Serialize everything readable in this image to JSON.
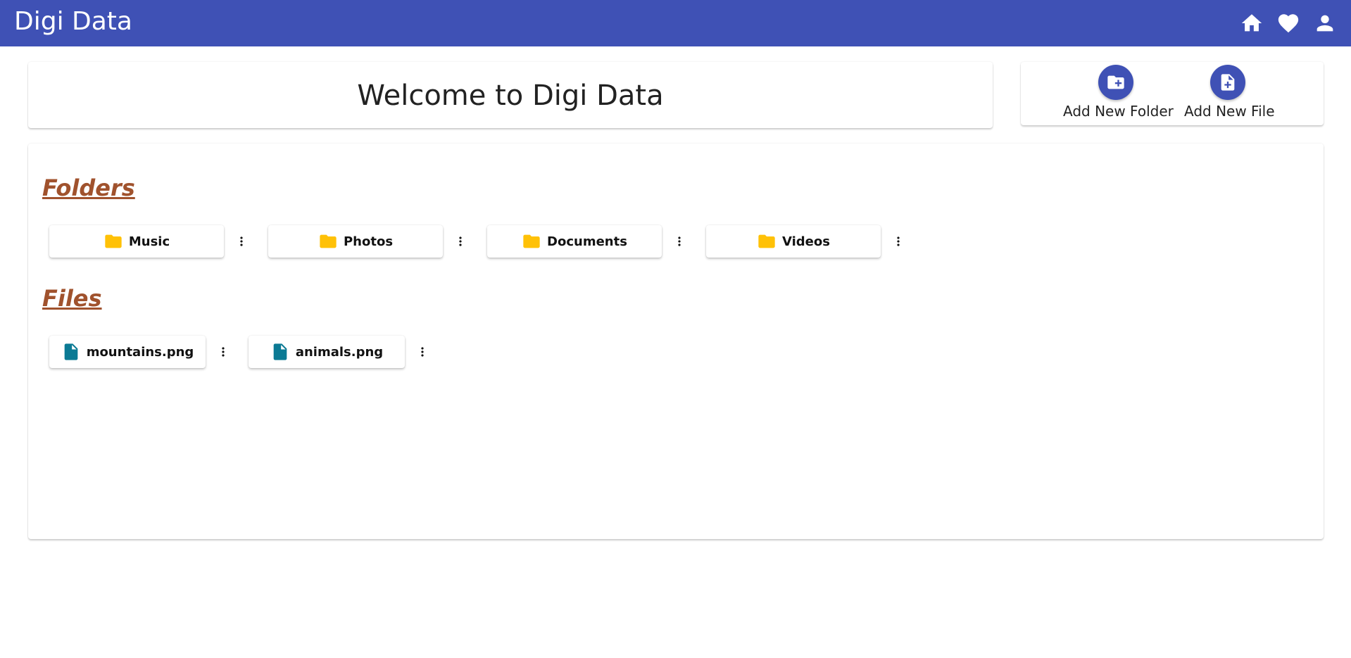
{
  "app": {
    "title": "Digi Data",
    "nav_icons": [
      "home-icon",
      "heart-icon",
      "person-icon"
    ]
  },
  "welcome": {
    "title": "Welcome to Digi Data"
  },
  "actions": {
    "add_folder_label": "Add New Folder",
    "add_file_label": "Add New File"
  },
  "folders": {
    "heading": "Folders",
    "items": [
      {
        "name": "Music"
      },
      {
        "name": "Photos"
      },
      {
        "name": "Documents"
      },
      {
        "name": "Videos"
      }
    ]
  },
  "files": {
    "heading": "Files",
    "items": [
      {
        "name": "mountains.png"
      },
      {
        "name": "animals.png"
      }
    ]
  },
  "colors": {
    "primary": "#3f51b5",
    "folder_icon": "#ffc107",
    "file_icon": "#0b7a94",
    "section_heading": "#a0522d"
  }
}
